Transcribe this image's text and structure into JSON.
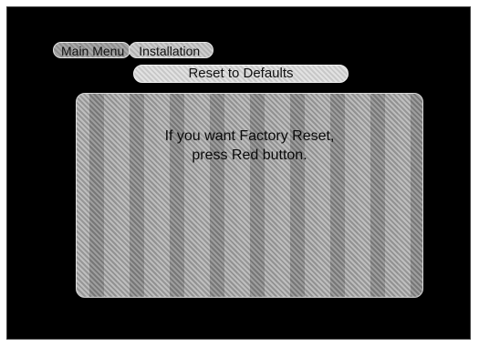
{
  "breadcrumb": {
    "main_menu": "Main Menu",
    "installation": "Installation"
  },
  "screen_title": "Reset to Defaults",
  "message": {
    "line1": "If you want Factory Reset,",
    "line2": "press Red button."
  },
  "colors": {
    "screen_background": "#000000",
    "pill_gray": "#c0c0c0"
  }
}
